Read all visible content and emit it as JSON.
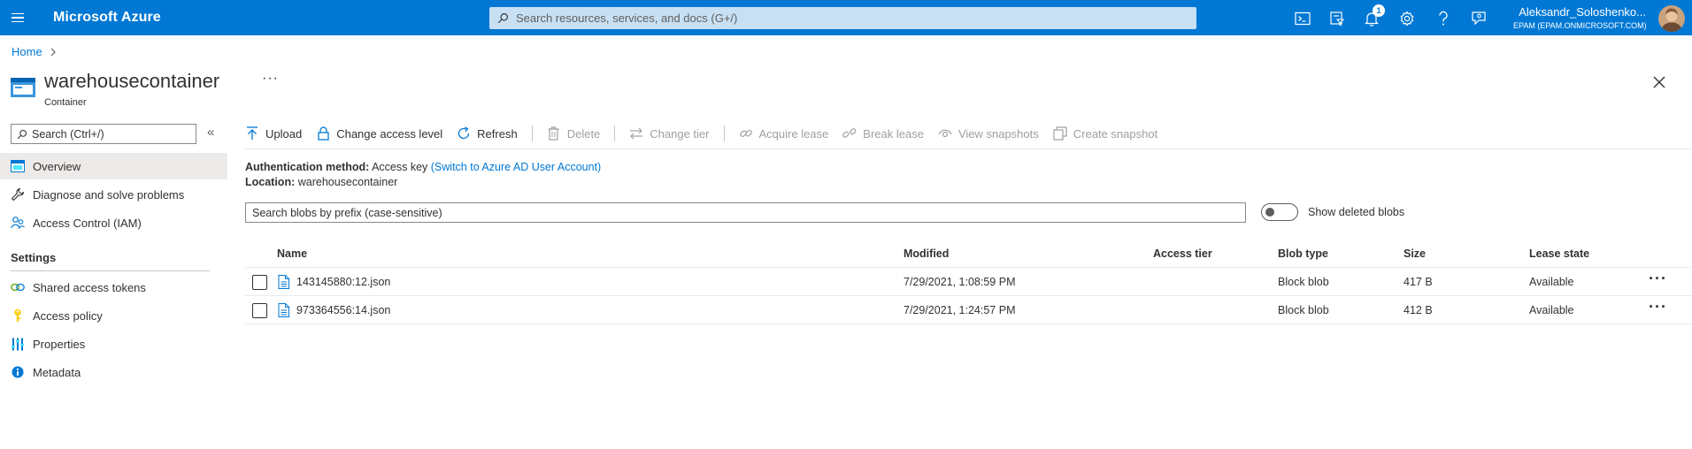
{
  "topbar": {
    "brand": "Microsoft Azure",
    "search_placeholder": "Search resources, services, and docs (G+/)",
    "notification_count": "1",
    "user_name": "Aleksandr_Soloshenko...",
    "user_tenant": "EPAM (EPAM.ONMICROSOFT.COM)",
    "icons": [
      "cloud-shell-icon",
      "directory-filter-icon",
      "notifications-icon",
      "settings-icon",
      "help-icon",
      "feedback-icon"
    ]
  },
  "breadcrumb": {
    "home": "Home",
    "separator": ">"
  },
  "resource": {
    "title": "warehousecontainer",
    "subtitle": "Container",
    "more": "···"
  },
  "nav": {
    "search_placeholder": "Search (Ctrl+/)",
    "collapse": "«",
    "items": [
      {
        "label": "Overview",
        "icon": "overview-icon"
      },
      {
        "label": "Diagnose and solve problems",
        "icon": "wrench-icon"
      },
      {
        "label": "Access Control (IAM)",
        "icon": "people-icon"
      }
    ],
    "section_settings": "Settings",
    "settings_items": [
      {
        "label": "Shared access tokens",
        "icon": "link-icon"
      },
      {
        "label": "Access policy",
        "icon": "key-icon"
      },
      {
        "label": "Properties",
        "icon": "properties-icon"
      },
      {
        "label": "Metadata",
        "icon": "info-icon"
      }
    ]
  },
  "commands": {
    "upload": "Upload",
    "change_access_level": "Change access level",
    "refresh": "Refresh",
    "delete": "Delete",
    "change_tier": "Change tier",
    "acquire_lease": "Acquire lease",
    "break_lease": "Break lease",
    "view_snapshots": "View snapshots",
    "create_snapshot": "Create snapshot"
  },
  "essentials": {
    "auth_label": "Authentication method:",
    "auth_value": "Access key",
    "auth_link": "(Switch to Azure AD User Account)",
    "location_label": "Location:",
    "location_value": "warehousecontainer"
  },
  "blob_search_placeholder": "Search blobs by prefix (case-sensitive)",
  "show_deleted_label": "Show deleted blobs",
  "grid": {
    "headers": {
      "name": "Name",
      "modified": "Modified",
      "access_tier": "Access tier",
      "blob_type": "Blob type",
      "size": "Size",
      "lease_state": "Lease state"
    },
    "rows": [
      {
        "name": "143145880:12.json",
        "modified": "7/29/2021, 1:08:59 PM",
        "access_tier": "",
        "blob_type": "Block blob",
        "size": "417 B",
        "lease_state": "Available",
        "more": "···"
      },
      {
        "name": "973364556:14.json",
        "modified": "7/29/2021, 1:24:57 PM",
        "access_tier": "",
        "blob_type": "Block blob",
        "size": "412 B",
        "lease_state": "Available",
        "more": "···"
      }
    ]
  },
  "colors": {
    "azure_blue": "#0078d4",
    "search_bg": "#c7e0f4",
    "disabled_text": "#a19f9d",
    "selected_nav": "#edebe9"
  }
}
